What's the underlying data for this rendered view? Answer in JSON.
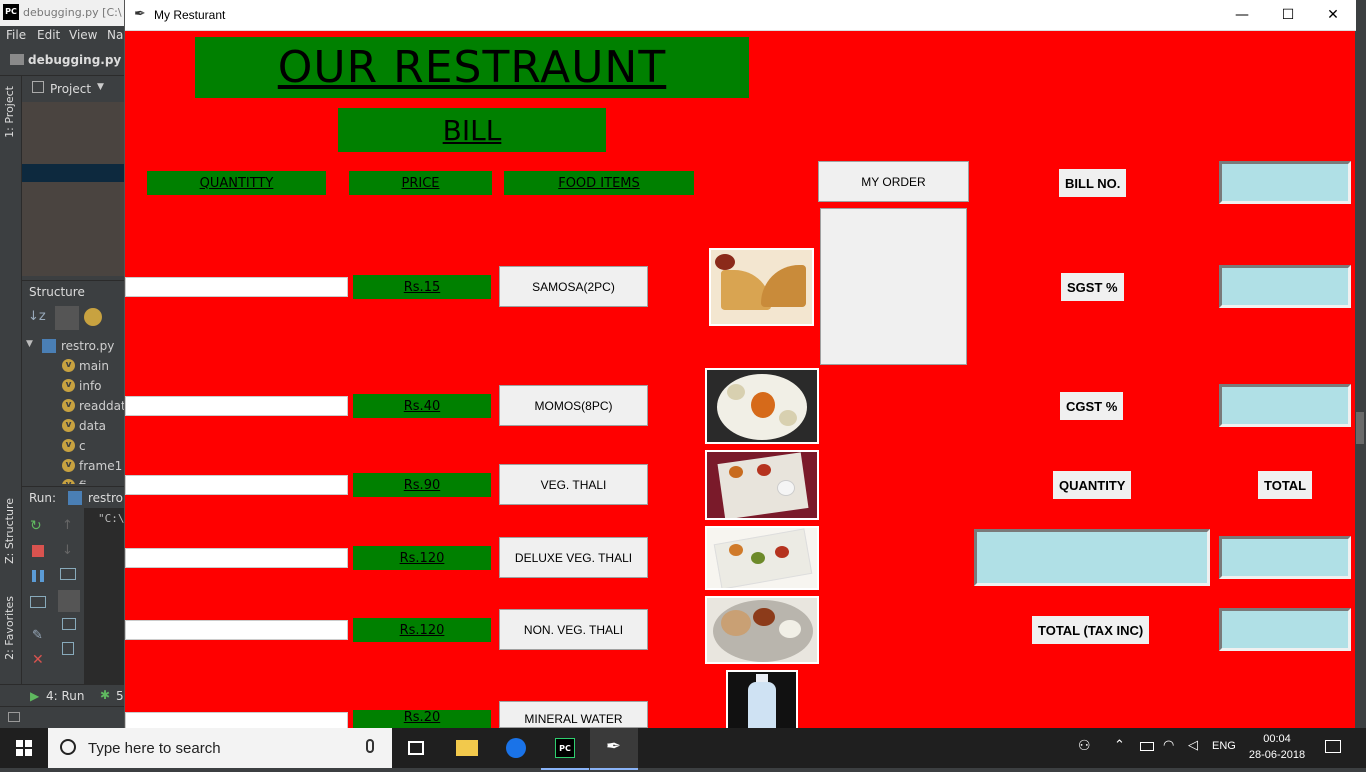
{
  "ide": {
    "title": "debugging.py [C:\\",
    "logo": "PC",
    "menu": [
      "File",
      "Edit",
      "View",
      "Na"
    ],
    "nav_file": "debugging.py",
    "project_label": "Project",
    "side_tab_project": "1: Project",
    "side_tab_structure": "Z: Structure",
    "side_tab_favorites": "2: Favorites",
    "structure_title": "Structure",
    "structure_file": "restro.py",
    "structure_items": [
      "main",
      "info",
      "readdata",
      "data",
      "c",
      "frame1",
      "fi"
    ],
    "run_label": "Run:",
    "run_name": "restro",
    "run_output": "\"C:\\",
    "bottom_tab_run": "4: Run",
    "bottom_tab_other": "5"
  },
  "window": {
    "title": "My Resturant",
    "minimize": "—",
    "maximize": "☐",
    "close": "✕"
  },
  "app": {
    "title": "OUR RESTRAUNT",
    "bill_heading": "BILL",
    "headers": {
      "quantity": "QUANTITTY",
      "price": "PRICE",
      "food_items": "FOOD ITEMS"
    },
    "items": [
      {
        "price": "Rs.15",
        "name": "SAMOSA(2PC)",
        "image": "samosa-image"
      },
      {
        "price": "Rs.40",
        "name": "MOMOS(8PC)",
        "image": "momos-image"
      },
      {
        "price": "Rs.90",
        "name": "VEG. THALI",
        "image": "veg-thali-image"
      },
      {
        "price": "Rs.120",
        "name": "DELUXE VEG. THALI",
        "image": "deluxe-thali-image"
      },
      {
        "price": "Rs.120",
        "name": "NON. VEG. THALI",
        "image": "nonveg-thali-image"
      },
      {
        "price": "Rs.20",
        "name": "MINERAL WATER",
        "image": "water-bottle-image"
      }
    ],
    "my_order_button": "MY ORDER",
    "right_labels": {
      "bill_no": "BILL NO.",
      "sgst": "SGST %",
      "cgst": "CGST %",
      "quantity": "QUANTITY",
      "total": "TOTAL",
      "total_tax_inc": "TOTAL (TAX INC)"
    },
    "colors": {
      "background": "#ff0000",
      "label_bg": "#008000",
      "entry_bg": "#b0e0e6"
    }
  },
  "taskbar": {
    "search_placeholder": "Type here to search",
    "language": "ENG",
    "time": "00:04",
    "date": "28-06-2018"
  }
}
